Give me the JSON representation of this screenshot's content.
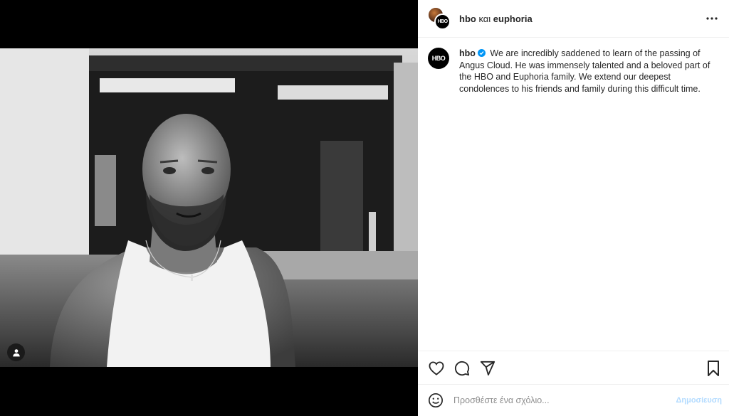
{
  "post": {
    "header": {
      "primary_account": "hbo",
      "conjunction": " και ",
      "collab_account": "euphoria"
    },
    "caption": {
      "username": "hbo",
      "text": "We are incredibly saddened to learn of the passing of Angus Cloud. He was immensely talented and a beloved part of the HBO and Euphoria family. We extend our deepest condolences to his friends and family during this difficult time."
    },
    "avatar_text": "HBO",
    "comment": {
      "placeholder": "Προσθέστε ένα σχόλιο...",
      "submit_label": "Δημοσίευση"
    },
    "icons": {
      "more": "more-horizontal-icon",
      "like": "heart-icon",
      "comment": "comment-bubble-icon",
      "share": "paper-plane-icon",
      "save": "bookmark-icon",
      "emoji": "emoji-smile-icon",
      "user_tag": "user-tag-icon",
      "verified": "verified-badge-icon"
    },
    "colors": {
      "verified_blue": "#0095f6",
      "post_disabled": "#b3dbff"
    }
  }
}
